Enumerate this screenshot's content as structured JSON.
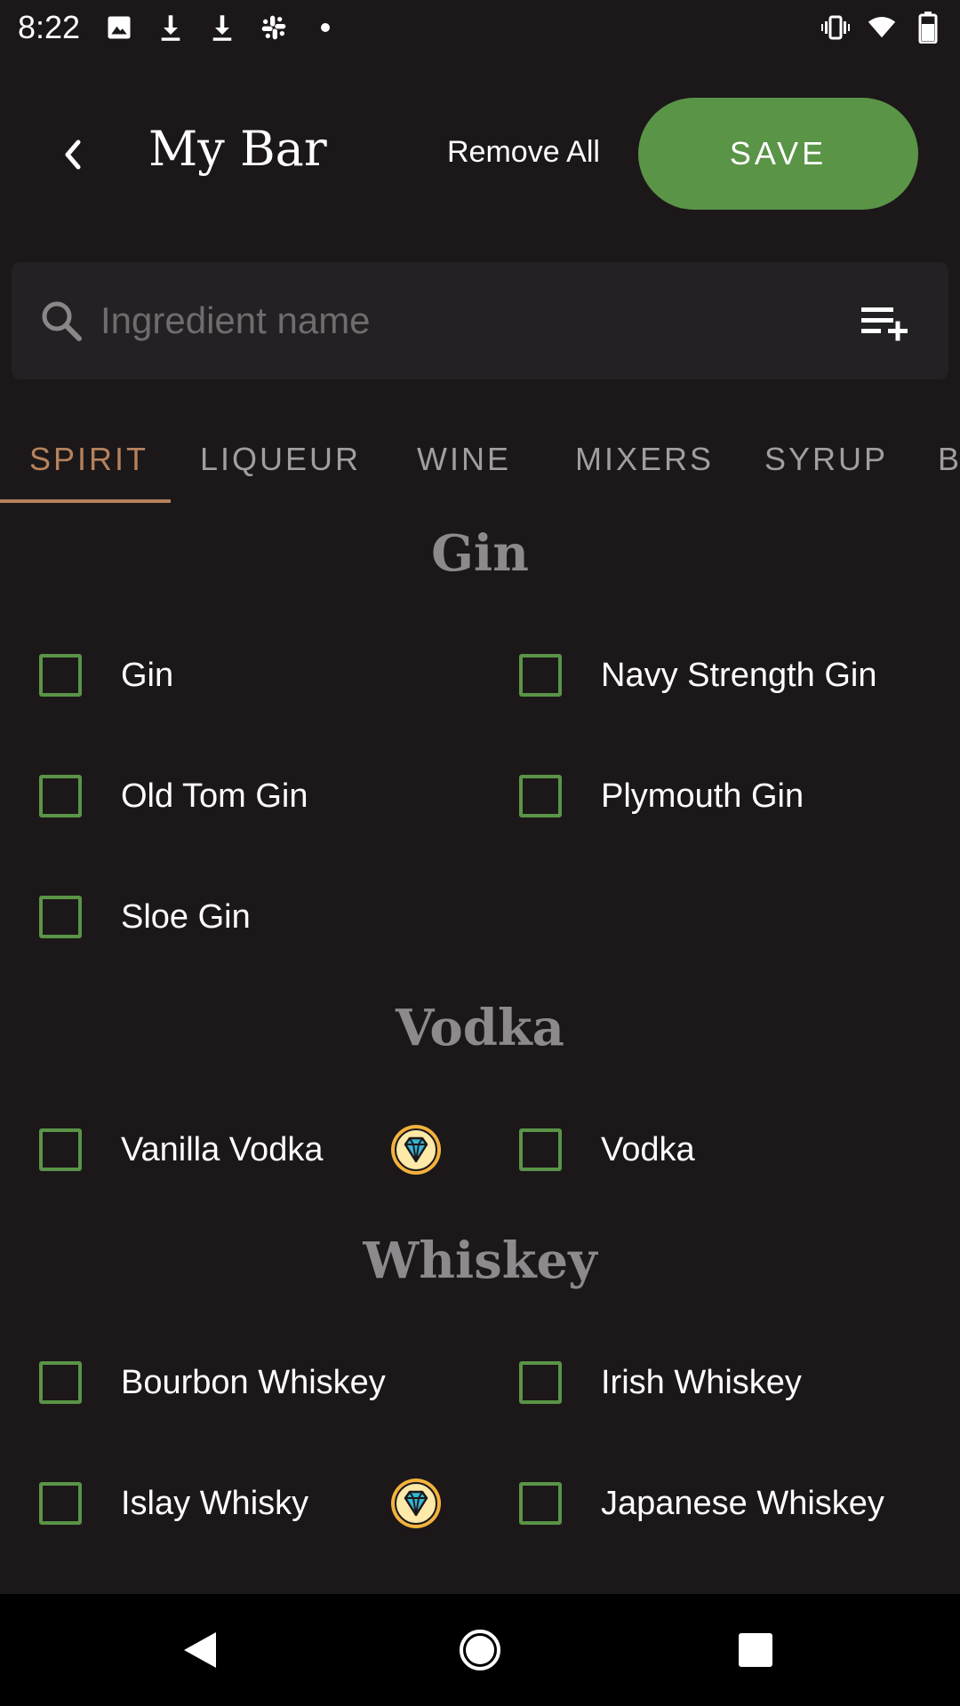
{
  "status_bar": {
    "time": "8:22",
    "icons_left": [
      "image-icon",
      "download-icon",
      "download-icon",
      "slack-icon",
      "dot-icon"
    ],
    "icons_right": [
      "vibrate-icon",
      "wifi-icon",
      "battery-icon"
    ]
  },
  "toolbar": {
    "back_icon": "chevron-left-icon",
    "title": "My Bar",
    "remove_all_label": "Remove All",
    "save_label": "SAVE",
    "save_color": "#5a9447"
  },
  "search": {
    "placeholder": "Ingredient name",
    "value": ""
  },
  "tabs": [
    {
      "label": "SPIRIT",
      "active": true
    },
    {
      "label": "LIQUEUR",
      "active": false
    },
    {
      "label": "WINE",
      "active": false
    },
    {
      "label": "MIXERS",
      "active": false
    },
    {
      "label": "SYRUP",
      "active": false
    },
    {
      "label": "B",
      "active": false
    }
  ],
  "accent_color": "#b5825d",
  "sections": [
    {
      "title": "Gin",
      "items": [
        {
          "label": "Gin",
          "checked": false,
          "premium": false
        },
        {
          "label": "Navy Strength Gin",
          "checked": false,
          "premium": false
        },
        {
          "label": "Old Tom Gin",
          "checked": false,
          "premium": false
        },
        {
          "label": "Plymouth Gin",
          "checked": false,
          "premium": false
        },
        {
          "label": "Sloe Gin",
          "checked": false,
          "premium": false
        }
      ]
    },
    {
      "title": "Vodka",
      "items": [
        {
          "label": "Vanilla Vodka",
          "checked": false,
          "premium": true
        },
        {
          "label": "Vodka",
          "checked": false,
          "premium": false
        }
      ]
    },
    {
      "title": "Whiskey",
      "items": [
        {
          "label": "Bourbon Whiskey",
          "checked": false,
          "premium": false
        },
        {
          "label": "Irish Whiskey",
          "checked": false,
          "premium": false
        },
        {
          "label": "Islay Whisky",
          "checked": false,
          "premium": true
        },
        {
          "label": "Japanese Whiskey",
          "checked": false,
          "premium": false
        }
      ]
    }
  ],
  "nav_bar": {
    "back_icon": "triangle-back-icon",
    "home_icon": "circle-home-icon",
    "recents_icon": "square-recents-icon"
  }
}
